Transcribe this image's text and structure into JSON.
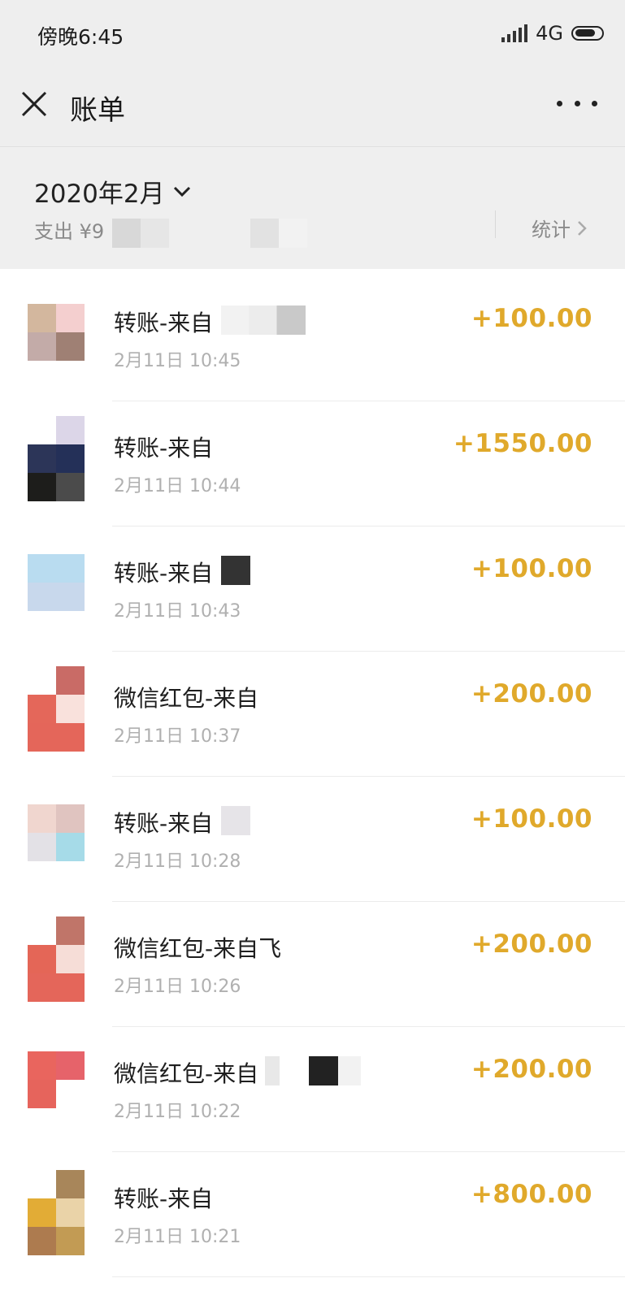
{
  "status_bar": {
    "time": "傍晚6:45",
    "network": "4G"
  },
  "header": {
    "title": "账单"
  },
  "month_section": {
    "month": "2020年2月",
    "summary_prefix": "支出 ¥9",
    "stats_label": "统计"
  },
  "transactions": [
    {
      "title": "转账-来自",
      "time": "2月11日 10:45",
      "amount": "+100.00",
      "avatar_colors": [
        "#d3b79e",
        "#f4cfcf",
        "#c3aba8",
        "#9f8074"
      ]
    },
    {
      "title": "转账-来自",
      "time": "2月11日 10:44",
      "amount": "+1550.00",
      "avatar_colors": [
        "#ffffff",
        "#dcd6e8",
        "#2c3558",
        "#243058",
        "#1d1d1b",
        "#4b4b4b"
      ]
    },
    {
      "title": "转账-来自",
      "time": "2月11日 10:43",
      "amount": "+100.00",
      "avatar_colors": [
        "#b9dcf0",
        "#b9dcf0",
        "#c8d8ec",
        "#c8d8ec"
      ]
    },
    {
      "title": "微信红包-来自",
      "time": "2月11日 10:37",
      "amount": "+200.00",
      "avatar_colors": [
        "#ffffff",
        "#c96b66",
        "#e4675a",
        "#f9e1dc",
        "#e4665a",
        "#e4665a"
      ]
    },
    {
      "title": "转账-来自",
      "time": "2月11日 10:28",
      "amount": "+100.00",
      "avatar_colors": [
        "#f0d6cf",
        "#e0c4c0",
        "#e3e1e6",
        "#a6dbe8"
      ]
    },
    {
      "title": "微信红包-来自飞",
      "time": "2月11日 10:26",
      "amount": "+200.00",
      "avatar_colors": [
        "#ffffff",
        "#c07569",
        "#e46657",
        "#f6ddd7",
        "#e4665a",
        "#e4665a"
      ]
    },
    {
      "title": "微信红包-来自",
      "time": "2月11日 10:22",
      "amount": "+200.00",
      "avatar_colors": [
        "#e9655e",
        "#e6636a",
        "#e6645c",
        "#ffffff"
      ]
    },
    {
      "title": "转账-来自",
      "time": "2月11日 10:21",
      "amount": "+800.00",
      "avatar_colors": [
        "#ffffff",
        "#a8865a",
        "#e2ac36",
        "#ead3a8",
        "#ad7b4f",
        "#c29b54"
      ]
    }
  ]
}
